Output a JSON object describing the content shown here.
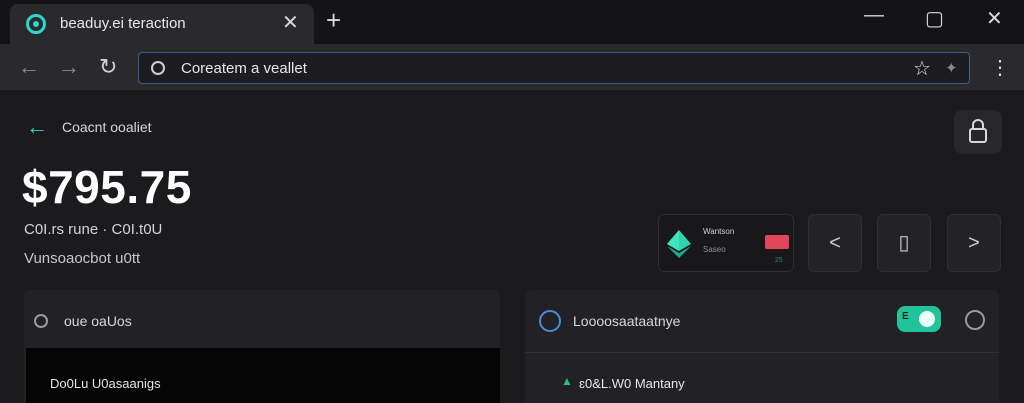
{
  "browser": {
    "tab_title": "beaduy.ei teraction",
    "tab_close": "✕",
    "new_tab": "+",
    "window_controls": [
      "—",
      "▢",
      "✕"
    ],
    "nav": {
      "back": "←",
      "forward": "→",
      "reload": "↻"
    },
    "url": "Coreatem a veallet",
    "star": "☆",
    "extension": "✦",
    "menu": "⋮"
  },
  "page": {
    "back_arrow": "←",
    "back_label": "Coacnt ooaliet",
    "balance": "$795.75",
    "subtitle_1": "C0I.rs rune · C0I.t0U",
    "subtitle_2": "Vunsoaocbot u0tt",
    "asset_card": {
      "name": "Wantson",
      "sub": "Saseo",
      "tiny": "25"
    },
    "pager": {
      "prev": "<",
      "device": "▯",
      "next": ">"
    },
    "left_panel": {
      "title": "oue oaUos",
      "body_text": "Do0Lu U0asaanigs"
    },
    "right_panel": {
      "title": "Loooosaataatnye",
      "toggle_label": "E",
      "change_indicator": "▲",
      "change_text": "ɛ0&L.W0 Mantany"
    }
  },
  "colors": {
    "accent": "#2fd3d0",
    "toggle_on": "#22c39a",
    "positive": "#23c07a",
    "negative": "#e0475a",
    "omnibox_border": "#3a5f8a"
  }
}
